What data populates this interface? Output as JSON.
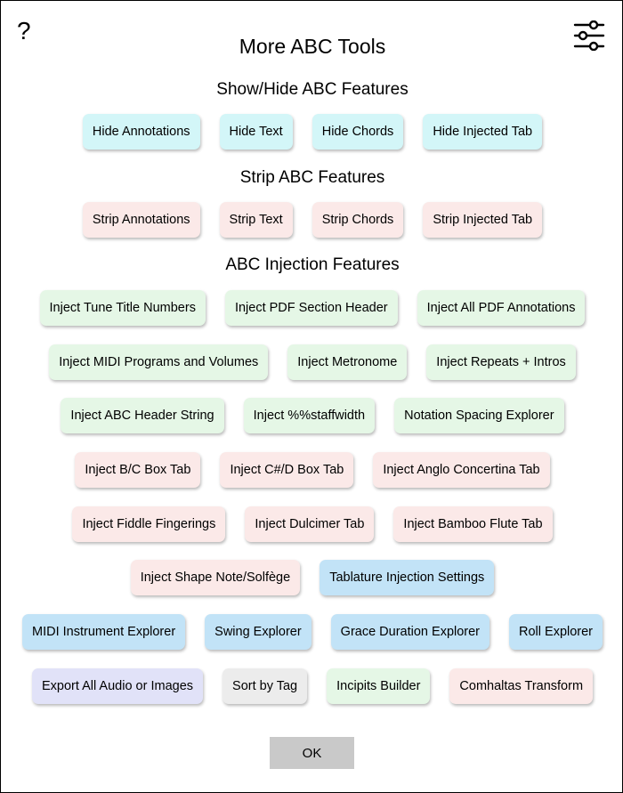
{
  "dialog": {
    "help_glyph": "?",
    "settings_icon": "sliders-icon",
    "title": "More ABC Tools",
    "ok_label": "OK"
  },
  "sections": {
    "show_hide": {
      "heading": "Show/Hide ABC Features",
      "buttons": [
        "Hide Annotations",
        "Hide Text",
        "Hide Chords",
        "Hide Injected Tab"
      ]
    },
    "strip": {
      "heading": "Strip ABC Features",
      "buttons": [
        "Strip Annotations",
        "Strip Text",
        "Strip Chords",
        "Strip Injected Tab"
      ]
    },
    "injection": {
      "heading": "ABC Injection Features",
      "rows": [
        [
          "Inject Tune Title Numbers",
          "Inject PDF Section Header",
          "Inject All PDF Annotations"
        ],
        [
          "Inject MIDI Programs and Volumes",
          "Inject Metronome",
          "Inject Repeats + Intros"
        ],
        [
          "Inject ABC Header String",
          "Inject %%staffwidth",
          "Notation Spacing Explorer"
        ],
        [
          "Inject B/C Box Tab",
          "Inject C#/D Box Tab",
          "Inject Anglo Concertina Tab"
        ],
        [
          "Inject Fiddle Fingerings",
          "Inject Dulcimer Tab",
          "Inject Bamboo Flute Tab"
        ],
        [
          "Inject Shape Note/Solfège",
          "Tablature Injection Settings"
        ],
        [
          "MIDI Instrument Explorer",
          "Swing Explorer",
          "Grace Duration Explorer",
          "Roll Explorer"
        ],
        [
          "Export All Audio or Images",
          "Sort by Tag",
          "Incipits Builder",
          "Comhaltas Transform"
        ]
      ]
    }
  },
  "colors": {
    "cyan": "#d3f6f8",
    "pink": "#fbe9e8",
    "green": "#e5f7e6",
    "blue": "#c2e3f7",
    "lavender": "#e1e2f8",
    "gray": "#ececec",
    "ok": "#c9c9c9"
  }
}
